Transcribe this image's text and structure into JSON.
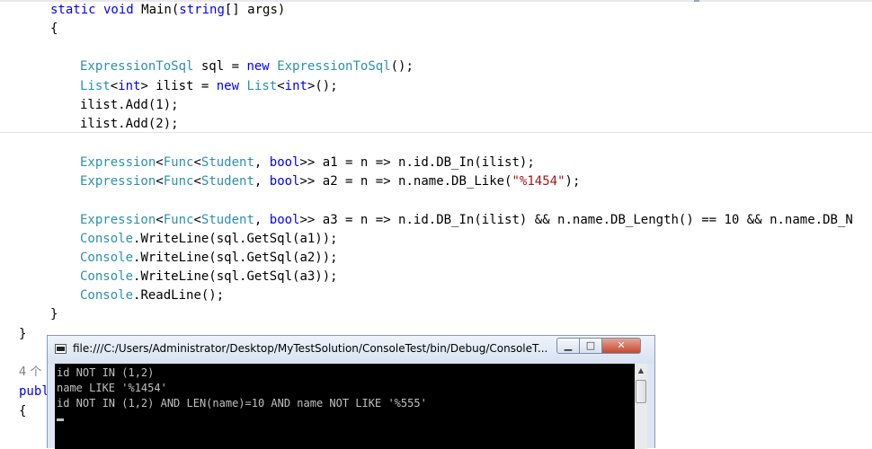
{
  "editor": {
    "lines": {
      "l1": {
        "a": "static void",
        "b": " Main(",
        "c": "string",
        "d": "[] args)"
      },
      "l2": {
        "a": "{"
      },
      "l3": {
        "a": "ExpressionToSql",
        "b": " sql = ",
        "c": "new",
        "d": " ",
        "e": "ExpressionToSql",
        "f": "();"
      },
      "l4": {
        "a": "List",
        "b": "<",
        "c": "int",
        "d": "> ilist = ",
        "e": "new",
        "f": " ",
        "g": "List",
        "h": "<",
        "i": "int",
        "j": ">();"
      },
      "l5": {
        "a": "ilist.Add(1);"
      },
      "l6": {
        "a": "ilist.Add(2);"
      },
      "l7": {
        "a": "Expression",
        "b": "<",
        "c": "Func",
        "d": "<",
        "e": "Student",
        "f": ", ",
        "g": "bool",
        "h": ">> a1 = n => n.id.DB_In(ilist);"
      },
      "l8": {
        "a": "Expression",
        "b": "<",
        "c": "Func",
        "d": "<",
        "e": "Student",
        "f": ", ",
        "g": "bool",
        "h": ">> a2 = n => n.name.DB_Like(",
        "i": "\"%1454\"",
        "j": ");"
      },
      "l9": {
        "a": "Expression",
        "b": "<",
        "c": "Func",
        "d": "<",
        "e": "Student",
        "f": ", ",
        "g": "bool",
        "h": ">> a3 = n => n.id.DB_In(ilist) && n.name.DB_Length() == 10 && n.name.DB_N"
      },
      "l10": {
        "a": "Console",
        "b": ".WriteLine(sql.GetSql(a1));"
      },
      "l11": {
        "a": "Console",
        "b": ".WriteLine(sql.GetSql(a2));"
      },
      "l12": {
        "a": "Console",
        "b": ".WriteLine(sql.GetSql(a3));"
      },
      "l13": {
        "a": "Console",
        "b": ".ReadLine();"
      },
      "l14": {
        "a": "}"
      },
      "l15": {
        "a": "}"
      },
      "l16": {
        "a": "4 个"
      },
      "l17": {
        "a": "publ"
      },
      "l18": {
        "a": "{"
      }
    }
  },
  "console": {
    "title": "file:///C:/Users/Administrator/Desktop/MyTestSolution/ConsoleTest/bin/Debug/ConsoleT...",
    "minimize": "▁",
    "maximize": "□",
    "close": "✕",
    "output": [
      "id NOT IN (1,2)",
      "name LIKE '%1454'",
      "id NOT IN (1,2) AND LEN(name)=10 AND name NOT LIKE '%555'"
    ],
    "scroll_up": "▲"
  },
  "colors": {
    "keyword": "#0000ff",
    "type": "#2b91af",
    "string": "#a31515"
  }
}
